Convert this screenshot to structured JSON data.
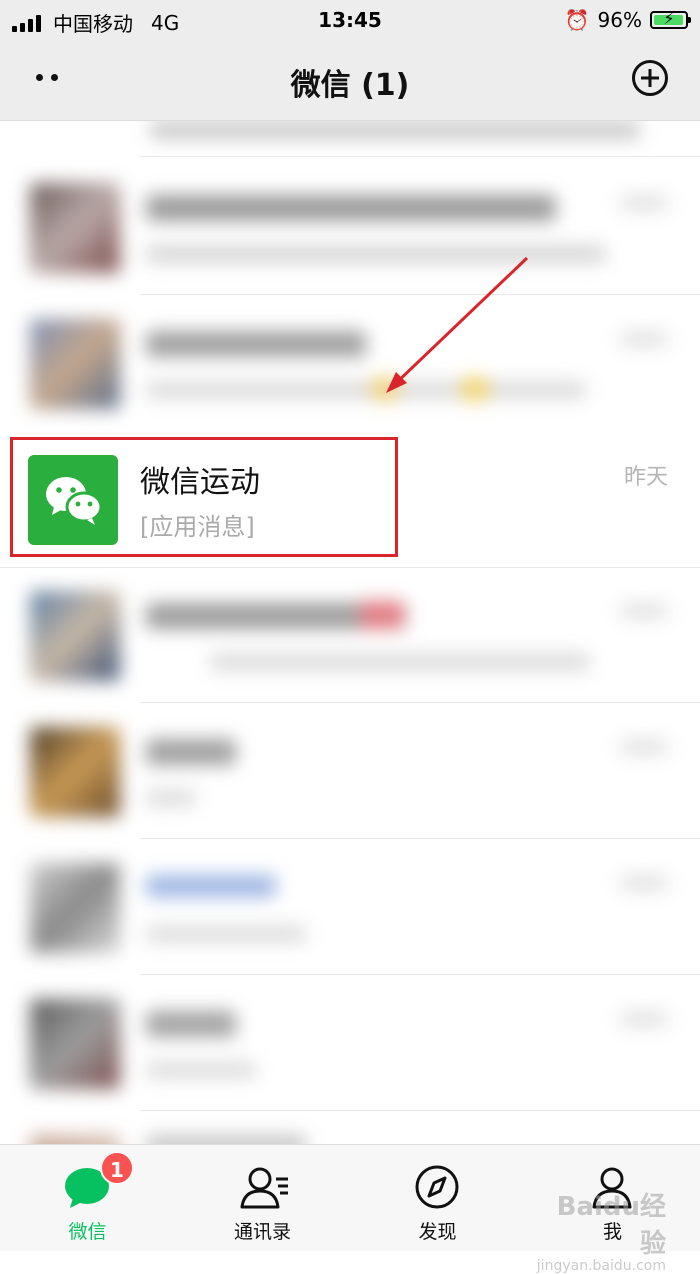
{
  "status_bar": {
    "carrier": "中国移动",
    "network": "4G",
    "time": "13:45",
    "battery": "96%",
    "battery_level": 0.96
  },
  "nav": {
    "title": "微信 (1)"
  },
  "chats": [
    {
      "title": "微信运动",
      "subtitle": "[应用消息]",
      "time": "昨天"
    }
  ],
  "tabs": [
    {
      "label": "微信",
      "badge": "1",
      "icon": "chat-bubble-icon",
      "active": true
    },
    {
      "label": "通讯录",
      "icon": "contacts-icon",
      "active": false
    },
    {
      "label": "发现",
      "icon": "compass-icon",
      "active": false
    },
    {
      "label": "我",
      "icon": "person-icon",
      "active": false
    }
  ],
  "colors": {
    "accent": "#07c160",
    "app_icon_green": "#2aae3d",
    "badge": "#fa5151",
    "annotation": "#d9242b"
  },
  "watermark": {
    "brand": "Baidu经验",
    "url": "jingyan.baidu.com"
  }
}
